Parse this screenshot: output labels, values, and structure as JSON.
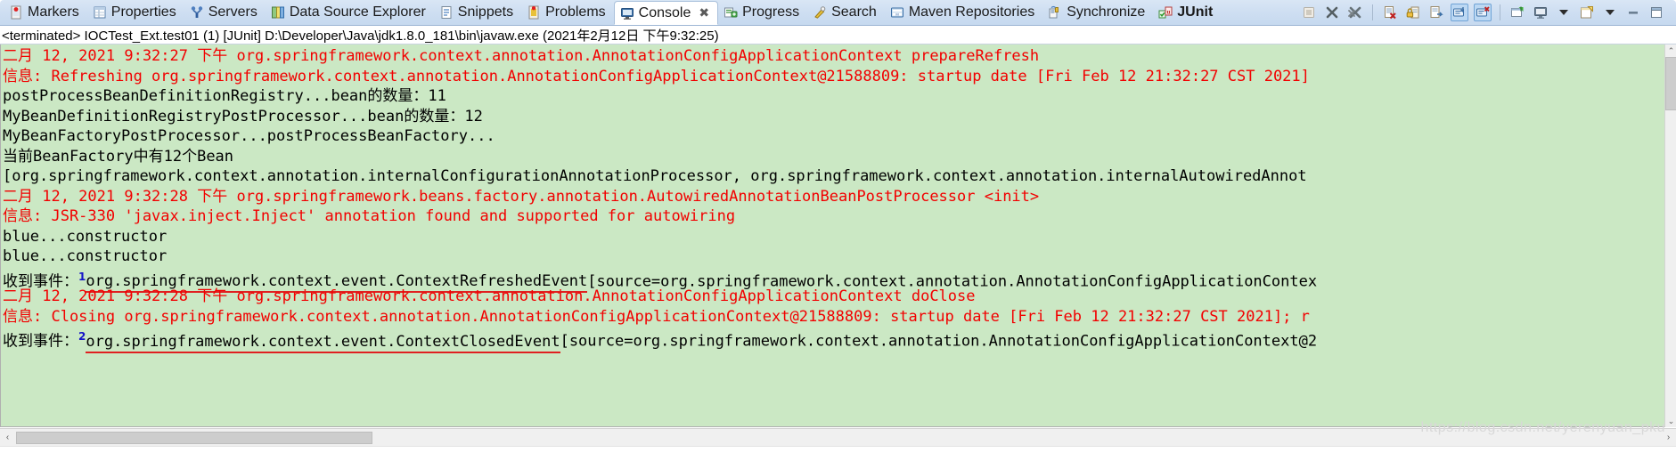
{
  "tabbar": {
    "tabs": [
      {
        "label": "Markers",
        "icon": "markers-icon",
        "active": false,
        "bold": false,
        "closable": false
      },
      {
        "label": "Properties",
        "icon": "properties-icon",
        "active": false,
        "bold": false,
        "closable": false
      },
      {
        "label": "Servers",
        "icon": "servers-icon",
        "active": false,
        "bold": false,
        "closable": false
      },
      {
        "label": "Data Source Explorer",
        "icon": "data-source-icon",
        "active": false,
        "bold": false,
        "closable": false
      },
      {
        "label": "Snippets",
        "icon": "snippets-icon",
        "active": false,
        "bold": false,
        "closable": false
      },
      {
        "label": "Problems",
        "icon": "problems-icon",
        "active": false,
        "bold": false,
        "closable": false
      },
      {
        "label": "Console",
        "icon": "console-icon",
        "active": true,
        "bold": false,
        "closable": true,
        "close_glyph": "✖"
      },
      {
        "label": "Progress",
        "icon": "progress-icon",
        "active": false,
        "bold": false,
        "closable": false
      },
      {
        "label": "Search",
        "icon": "search-icon",
        "active": false,
        "bold": false,
        "closable": false
      },
      {
        "label": "Maven Repositories",
        "icon": "maven-repositories-icon",
        "active": false,
        "bold": false,
        "closable": false
      },
      {
        "label": "Synchronize",
        "icon": "synchronize-icon",
        "active": false,
        "bold": false,
        "closable": false
      },
      {
        "label": "JUnit",
        "icon": "junit-icon",
        "active": false,
        "bold": true,
        "closable": false
      }
    ],
    "tools": [
      {
        "name": "terminate-button",
        "enabled": false
      },
      {
        "name": "remove-launch-button",
        "enabled": true
      },
      {
        "name": "remove-all-terminated-button",
        "enabled": true
      },
      {
        "name": "separator-1",
        "enabled": false
      },
      {
        "name": "clear-console-button",
        "enabled": true
      },
      {
        "name": "lock-scroll-button",
        "enabled": true
      },
      {
        "name": "word-wrap-button",
        "enabled": true
      },
      {
        "name": "scroll-lock-toggle",
        "enabled": true
      },
      {
        "name": "show-console-on-error-toggle",
        "enabled": true
      },
      {
        "name": "separator-2",
        "enabled": false
      },
      {
        "name": "pin-console-button",
        "enabled": true
      },
      {
        "name": "display-selected-console-button",
        "enabled": true
      },
      {
        "name": "display-selected-console-menu",
        "enabled": true
      },
      {
        "name": "open-console-button",
        "enabled": true
      },
      {
        "name": "open-console-menu",
        "enabled": true
      },
      {
        "name": "minimize-view-button",
        "enabled": true
      },
      {
        "name": "maximize-view-button",
        "enabled": true
      }
    ]
  },
  "process": {
    "line": "<terminated> IOCTest_Ext.test01 (1) [JUnit] D:\\Developer\\Java\\jdk1.8.0_181\\bin\\javaw.exe (2021年2月12日 下午9:32:25)"
  },
  "console": {
    "background_color": "#cbe8c4",
    "error_color": "#f20000",
    "output_color": "#000000",
    "annotation_color": "#e02020",
    "lines": [
      {
        "color": "red",
        "segments": [
          {
            "text": "二月",
            "cjk": true
          },
          {
            "text": " 12, 2021 9:32:27 "
          },
          {
            "text": "下午",
            "cjk": true
          },
          {
            "text": " org.springframework.context.annotation.AnnotationConfigApplicationContext prepareRefresh"
          }
        ]
      },
      {
        "color": "red",
        "segments": [
          {
            "text": "信息",
            "cjk": true
          },
          {
            "text": ": Refreshing org.springframework.context.annotation.AnnotationConfigApplicationContext@21588809: startup date [Fri Feb 12 21:32:27 CST 2021]"
          }
        ]
      },
      {
        "color": "black",
        "segments": [
          {
            "text": "postProcessBeanDefinitionRegistry...bean"
          },
          {
            "text": "的数量：",
            "cjk": true
          },
          {
            "text": "11"
          }
        ]
      },
      {
        "color": "black",
        "segments": [
          {
            "text": "MyBeanDefinitionRegistryPostProcessor...bean"
          },
          {
            "text": "的数量：",
            "cjk": true
          },
          {
            "text": "12"
          }
        ]
      },
      {
        "color": "black",
        "segments": [
          {
            "text": "MyBeanFactoryPostProcessor...postProcessBeanFactory..."
          }
        ]
      },
      {
        "color": "black",
        "segments": [
          {
            "text": "当前",
            "cjk": true
          },
          {
            "text": "BeanFactory"
          },
          {
            "text": "中有",
            "cjk": true
          },
          {
            "text": "12"
          },
          {
            "text": "个",
            "cjk": true
          },
          {
            "text": "Bean"
          }
        ]
      },
      {
        "color": "black",
        "segments": [
          {
            "text": "[org.springframework.context.annotation.internalConfigurationAnnotationProcessor, org.springframework.context.annotation.internalAutowiredAnnot"
          }
        ]
      },
      {
        "color": "red",
        "segments": [
          {
            "text": "二月",
            "cjk": true
          },
          {
            "text": " 12, 2021 9:32:28 "
          },
          {
            "text": "下午",
            "cjk": true
          },
          {
            "text": " org.springframework.beans.factory.annotation.AutowiredAnnotationBeanPostProcessor <init>"
          }
        ]
      },
      {
        "color": "red",
        "segments": [
          {
            "text": "信息",
            "cjk": true
          },
          {
            "text": ": JSR-330 'javax.inject.Inject' annotation found and supported for autowiring"
          }
        ]
      },
      {
        "color": "black",
        "segments": [
          {
            "text": "blue...constructor"
          }
        ]
      },
      {
        "color": "black",
        "segments": [
          {
            "text": "blue...constructor"
          }
        ]
      },
      {
        "color": "black",
        "segments": [
          {
            "text": "收到事件：",
            "cjk": true
          },
          {
            "text": "1",
            "sup": true
          },
          {
            "text": "org.springframework.context.event.ContextRefreshedEvent",
            "underline": true
          },
          {
            "text": "[source=org.springframework.context.annotation.AnnotationConfigApplicationContex"
          }
        ]
      },
      {
        "color": "red",
        "segments": [
          {
            "text": "二月",
            "cjk": true
          },
          {
            "text": " 12, 2021 9:32:28 "
          },
          {
            "text": "下午",
            "cjk": true
          },
          {
            "text": " org.springframework.context.annotation.AnnotationConfigApplicationContext doClose"
          }
        ]
      },
      {
        "color": "red",
        "segments": [
          {
            "text": "信息",
            "cjk": true
          },
          {
            "text": ": Closing org.springframework.context.annotation.AnnotationConfigApplicationContext@21588809: startup date [Fri Feb 12 21:32:27 CST 2021]; r"
          }
        ]
      },
      {
        "color": "black",
        "segments": [
          {
            "text": "收到事件：",
            "cjk": true
          },
          {
            "text": "2",
            "sup": true
          },
          {
            "text": "org.springframework.context.event.ContextClosedEvent",
            "underline": true
          },
          {
            "text": "[source=org.springframework.context.annotation.AnnotationConfigApplicationContext@2"
          }
        ]
      }
    ]
  },
  "scrollbars": {
    "vertical": {
      "up_glyph": "⌃",
      "down_glyph": "⌄"
    },
    "horizontal": {
      "left_glyph": "‹",
      "right_glyph": "›"
    }
  },
  "watermark": {
    "text": "https://blog.csdn.net/yerenyuan_pku"
  }
}
